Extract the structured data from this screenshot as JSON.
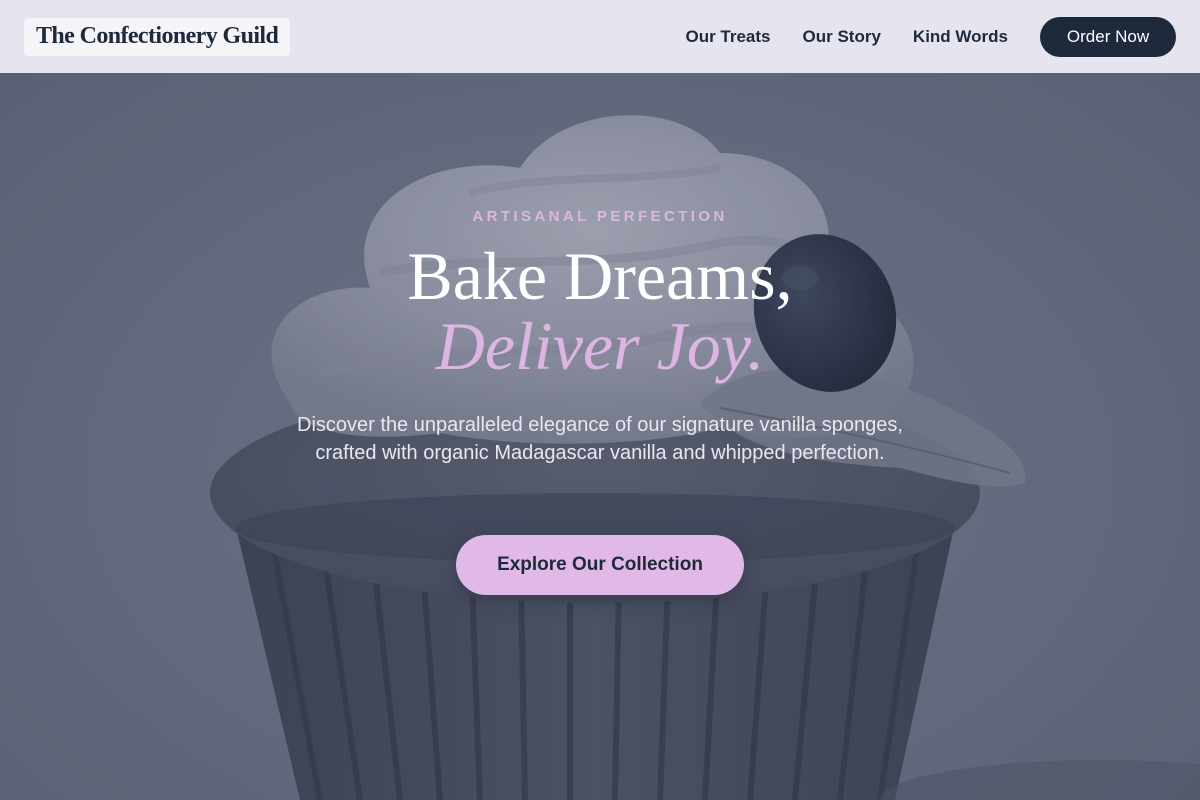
{
  "header": {
    "brand": "The Confectionery Guild",
    "nav": [
      "Our Treats",
      "Our Story",
      "Kind Words"
    ],
    "cta": "Order Now"
  },
  "hero": {
    "eyebrow": "ARTISANAL PERFECTION",
    "headline_line1": "Bake Dreams,",
    "headline_line2": "Deliver Joy.",
    "lead": "Discover the unparalleled elegance of our signature vanilla sponges, crafted with organic Madagascar vanilla and whipped perfection.",
    "cta": "Explore Our Collection",
    "image": "cupcake-photo"
  },
  "colors": {
    "navy": "#1e2a3c",
    "lavender": "#dcb5e3",
    "header_bg": "#e6e4ee",
    "hero_tint": "#6b7183"
  }
}
